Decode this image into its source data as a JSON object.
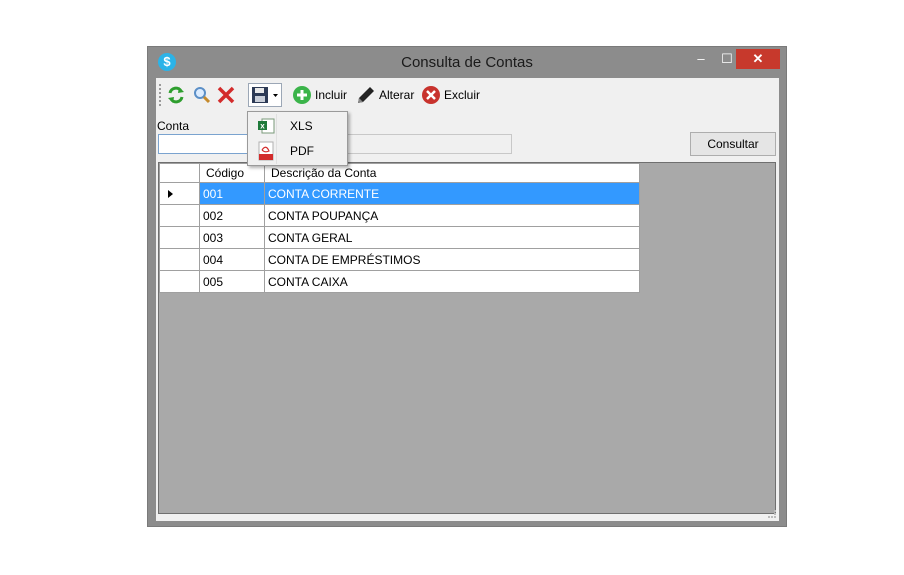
{
  "window": {
    "title": "Consulta de Contas",
    "app_icon_glyph": "$",
    "minimize_glyph": "–",
    "maximize_glyph": "☐",
    "close_glyph": "✕"
  },
  "toolbar": {
    "refresh_icon": "refresh-icon",
    "search_icon": "magnifier-icon",
    "clear_icon": "red-x-icon",
    "save_icon": "floppy-disk-icon",
    "incluir_label": "Incluir",
    "alterar_label": "Alterar",
    "excluir_label": "Excluir"
  },
  "export_menu": {
    "items": [
      {
        "label": "XLS",
        "icon": "excel-icon"
      },
      {
        "label": "PDF",
        "icon": "pdf-icon"
      }
    ]
  },
  "filter": {
    "conta_label": "Conta",
    "conta_value": "",
    "descricao_value": "",
    "consultar_label": "Consultar"
  },
  "grid": {
    "columns": [
      "Código",
      "Descrição da Conta"
    ],
    "rows": [
      {
        "codigo": "001",
        "descricao": "CONTA CORRENTE"
      },
      {
        "codigo": "002",
        "descricao": "CONTA POUPANÇA"
      },
      {
        "codigo": "003",
        "descricao": "CONTA GERAL"
      },
      {
        "codigo": "004",
        "descricao": "CONTA DE EMPRÉSTIMOS"
      },
      {
        "codigo": "005",
        "descricao": "CONTA CAIXA"
      }
    ],
    "selected_row": 0
  },
  "colors": {
    "selection": "#3399ff",
    "close_button": "#c7392c",
    "titlebar": "#8c8c8c"
  }
}
